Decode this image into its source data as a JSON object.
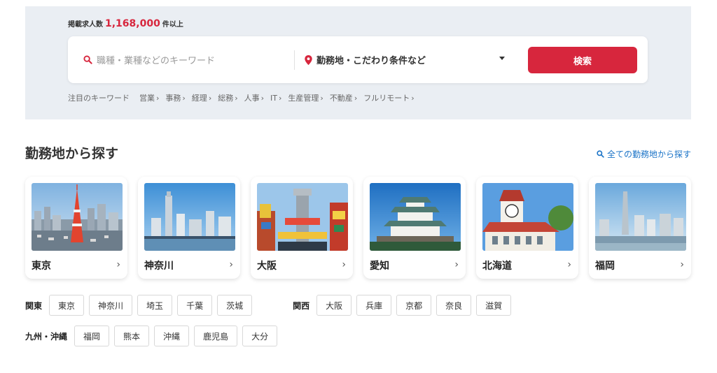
{
  "hero": {
    "count_prefix": "掲載求人数",
    "count_value": "1,168,000",
    "count_suffix": "件以上",
    "keyword_placeholder": "職種・業種などのキーワード",
    "location_label": "勤務地・こだわり条件など",
    "search_button": "検索",
    "featured_label": "注目のキーワード",
    "featured_keywords": [
      {
        "label": "営業",
        "arrow": "›"
      },
      {
        "label": "事務",
        "arrow": "›"
      },
      {
        "label": "経理",
        "arrow": "›"
      },
      {
        "label": "総務",
        "arrow": "›"
      },
      {
        "label": "人事",
        "arrow": "›"
      },
      {
        "label": "IT",
        "arrow": "›"
      },
      {
        "label": "生産管理",
        "arrow": "›"
      },
      {
        "label": "不動産",
        "arrow": "›"
      },
      {
        "label": "フルリモート",
        "arrow": "›"
      }
    ],
    "accent_color": "#d7263d"
  },
  "section": {
    "title": "勤務地から探す",
    "all_link": "全ての勤務地から探す"
  },
  "cards": [
    {
      "name": "東京",
      "chevron": "›",
      "icon": "tokyo-tower-photo"
    },
    {
      "name": "神奈川",
      "chevron": "›",
      "icon": "yokohama-skyline-photo"
    },
    {
      "name": "大阪",
      "chevron": "›",
      "icon": "tsutenkaku-photo"
    },
    {
      "name": "愛知",
      "chevron": "›",
      "icon": "nagoya-castle-photo"
    },
    {
      "name": "北海道",
      "chevron": "›",
      "icon": "sapporo-clock-tower-photo"
    },
    {
      "name": "福岡",
      "chevron": "›",
      "icon": "fukuoka-tower-photo"
    }
  ],
  "regions": {
    "kanto": {
      "label": "関東",
      "prefs": [
        "東京",
        "神奈川",
        "埼玉",
        "千葉",
        "茨城"
      ]
    },
    "kansai": {
      "label": "関西",
      "prefs": [
        "大阪",
        "兵庫",
        "京都",
        "奈良",
        "滋賀"
      ]
    },
    "kyushu": {
      "label": "九州・沖縄",
      "prefs": [
        "福岡",
        "熊本",
        "沖縄",
        "鹿児島",
        "大分"
      ]
    }
  }
}
